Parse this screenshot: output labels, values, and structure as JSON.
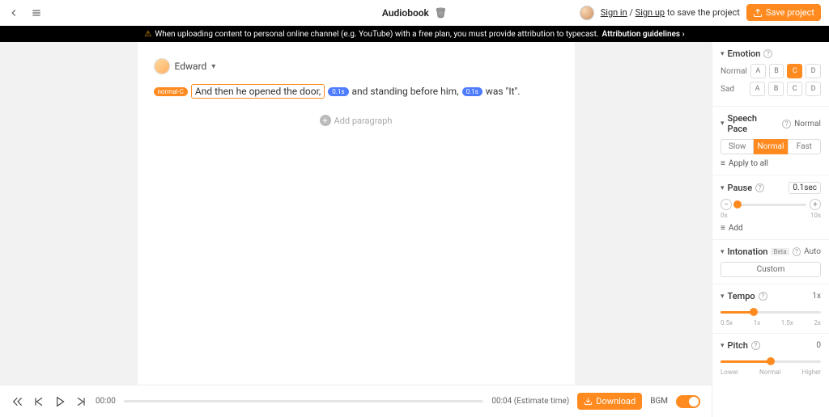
{
  "header": {
    "title": "Audiobook",
    "sign_in": "Sign in",
    "sign_up": "Sign up",
    "save_hint": " to save the project",
    "save_btn": "Save project"
  },
  "attribution": {
    "text": "When uploading content to personal online channel (e.g. YouTube) with a free plan, you must provide attribution to typecast.",
    "link": "Attribution guidelines"
  },
  "doc": {
    "speaker": "Edward",
    "emotion_tag": "normal-C",
    "seg1": "And then he opened the door,",
    "pause1": "0.1s",
    "seg2": "and standing before him,",
    "pause2": "0.1s",
    "seg3": "was \"It\".",
    "add_paragraph": "Add paragraph"
  },
  "player": {
    "cur_time": "00:00",
    "est_time": "00:04 (Estimate time)",
    "download": "Download",
    "bgm": "BGM"
  },
  "sidebar": {
    "emotion": {
      "title": "Emotion",
      "rows": [
        {
          "label": "Normal",
          "opts": [
            "A",
            "B",
            "C",
            "D"
          ],
          "active": 2
        },
        {
          "label": "Sad",
          "opts": [
            "A",
            "B",
            "C",
            "D"
          ],
          "active": -1
        }
      ]
    },
    "pace": {
      "title": "Speech Pace",
      "value": "Normal",
      "opts": [
        "Slow",
        "Normal",
        "Fast"
      ],
      "active": 1,
      "apply": "Apply to all"
    },
    "pause": {
      "title": "Pause",
      "value": "0.1sec",
      "min": "0s",
      "max": "10s",
      "fill_pct": 3,
      "add": "Add"
    },
    "intonation": {
      "title": "Intonation",
      "badge": "Beta",
      "value": "Auto",
      "custom": "Custom"
    },
    "tempo": {
      "title": "Tempo",
      "value": "1x",
      "ticks": [
        "0.5x",
        "1x",
        "1.5x",
        "2x"
      ],
      "fill_pct": 33
    },
    "pitch": {
      "title": "Pitch",
      "value": "0",
      "ticks": [
        "Lower",
        "Normal",
        "Higher"
      ],
      "fill_pct": 50
    }
  }
}
